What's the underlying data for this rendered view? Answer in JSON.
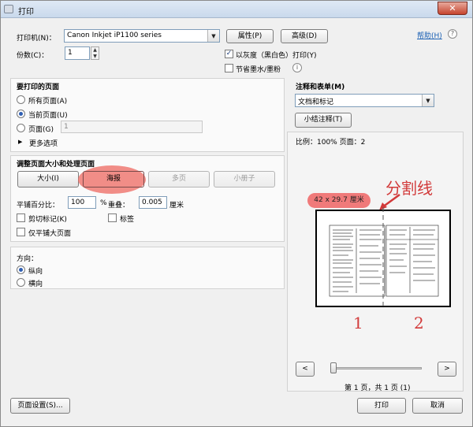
{
  "window": {
    "title": "打印",
    "close_label": "✕"
  },
  "printer": {
    "label": "打印机(N)：",
    "selected": "Canon Inkjet iP1100 series",
    "properties_button": "属性(P)",
    "advanced_button": "高级(D)",
    "help_link": "帮助(H)",
    "copies_label": "份数(C)：",
    "copies_value": "1",
    "grayscale_label": "以灰度（黑白色）打印(Y)",
    "grayscale_checked": true,
    "save_ink_label": "节省墨水/墨粉",
    "save_ink_checked": false
  },
  "pages": {
    "title": "要打印的页面",
    "all_label": "所有页面(A)",
    "current_label": "当前页面(U)",
    "range_label": "页面(G)",
    "range_value": "1",
    "more_options": "更多选项",
    "selected": "current"
  },
  "sizing": {
    "title": "调整页面大小和处理页面",
    "buttons": [
      "大小(I)",
      "海报",
      "多页",
      "小册子"
    ],
    "active": "海报",
    "tile_scale_label": "平铺百分比：",
    "tile_scale_value": "100",
    "tile_scale_unit": "%",
    "overlap_label": "重叠：",
    "overlap_value": "0.005",
    "overlap_unit": "厘米",
    "cut_marks_label": "剪切标记(K)",
    "labels_label": "标签",
    "tile_large_label": "仅平铺大页面"
  },
  "orientation": {
    "title": "方向：",
    "portrait_label": "纵向",
    "landscape_label": "横向",
    "selected": "portrait"
  },
  "annotations": {
    "title": "注释和表单(M)",
    "selected": "文档和标记",
    "summarize_button": "小结注释(T)"
  },
  "preview": {
    "scale_text": "比例：100% 页面：2",
    "dimension_badge": "42 x 29.7 厘米",
    "split_line_label": "分割线",
    "page1_label": "1",
    "page2_label": "2",
    "prev_button": "<",
    "next_button": ">",
    "page_status": "第 1 页，共 1 页 (1)"
  },
  "footer": {
    "page_setup_button": "页面设置(S)...",
    "print_button": "打印",
    "cancel_button": "取消"
  },
  "colors": {
    "highlight": "#ee6860",
    "annotation_red": "#d23a3a",
    "accent_blue": "#2f5fb3"
  }
}
